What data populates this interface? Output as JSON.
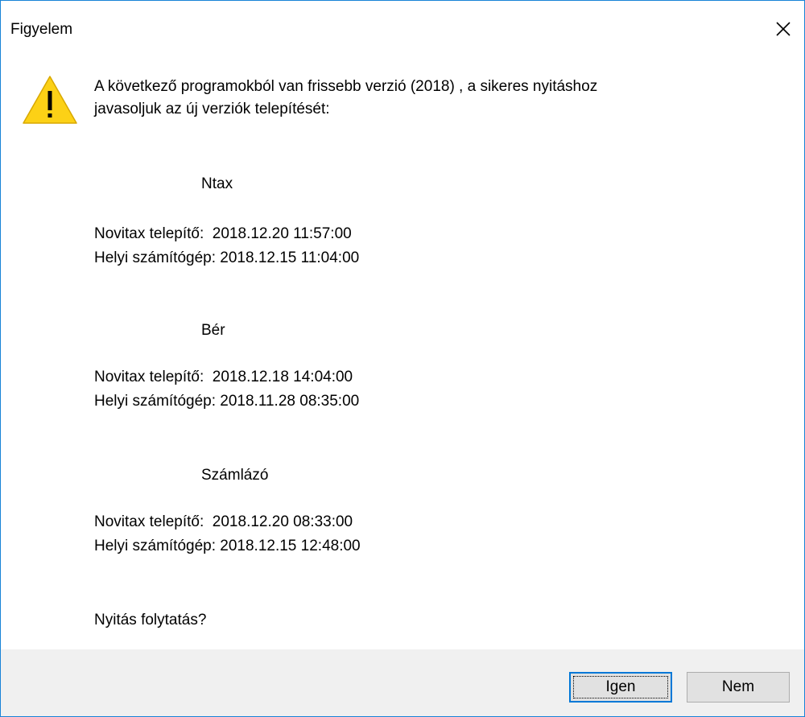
{
  "window": {
    "title": "Figyelem"
  },
  "dialog": {
    "message_line1": "A következő programokból van frissebb verzió (2018) , a sikeres nyitáshoz",
    "message_line2": "javasoljuk az új verziók telepítését:",
    "sections": [
      {
        "name": "Ntax",
        "installer": "Novitax telepítő:  2018.12.20 11:57:00",
        "local": "Helyi számítógép: 2018.12.15 11:04:00"
      },
      {
        "name": "Bér",
        "installer": "Novitax telepítő:  2018.12.18 14:04:00",
        "local": "Helyi számítógép: 2018.11.28 08:35:00"
      },
      {
        "name": "Számlázó",
        "installer": "Novitax telepítő:  2018.12.20 08:33:00",
        "local": "Helyi számítógép: 2018.12.15 12:48:00"
      }
    ],
    "question": "Nyitás folytatás?"
  },
  "buttons": {
    "yes_mnemonic": "I",
    "yes_rest": "gen",
    "no_mnemonic": "N",
    "no_rest": "em"
  },
  "icons": {
    "close": "close-icon",
    "warning": "warning-icon"
  },
  "colors": {
    "window_border": "#1883d7",
    "footer_bg": "#f0f0f0",
    "default_button_border": "#0078d7",
    "warning_yellow": "#fcd116"
  }
}
